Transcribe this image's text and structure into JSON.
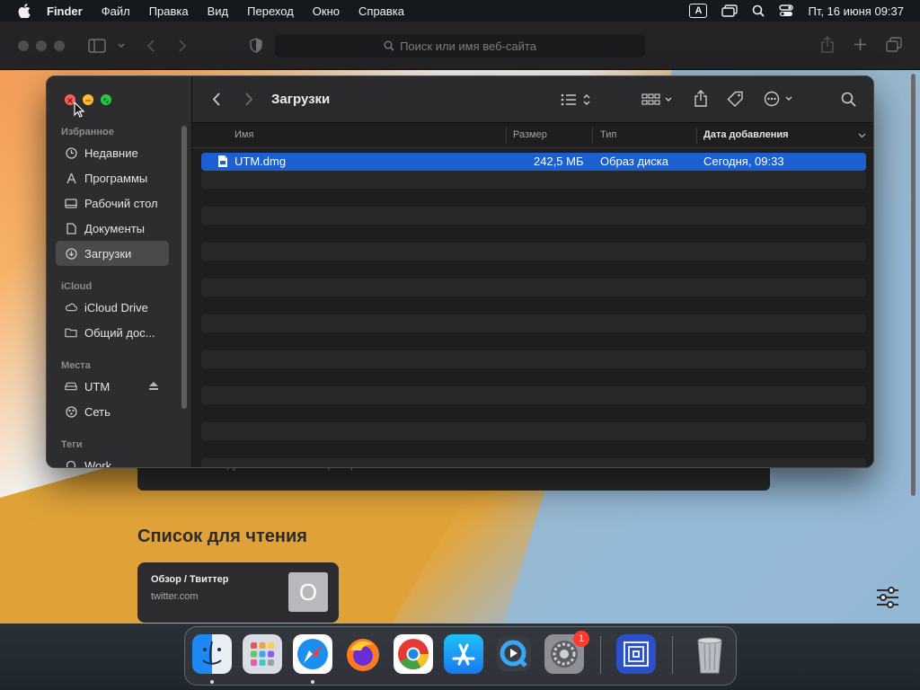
{
  "menubar": {
    "app_name": "Finder",
    "items": [
      "Файл",
      "Правка",
      "Вид",
      "Переход",
      "Окно",
      "Справка"
    ],
    "input_source": "A",
    "datetime": "Пт, 16 июня  09:37"
  },
  "safari": {
    "address_placeholder": "Поиск или имя веб-сайта",
    "privacy_text": "IP-адрес от известных трекеров.",
    "reading_list_title": "Список для чтения",
    "reading_item": {
      "title": "Обзор / Твиттер",
      "url": "twitter.com",
      "thumb_letter": "О"
    }
  },
  "finder": {
    "title": "Загрузки",
    "sidebar": {
      "favorites_label": "Избранное",
      "favorites": [
        {
          "label": "Недавние",
          "icon": "clock-icon"
        },
        {
          "label": "Программы",
          "icon": "applications-icon"
        },
        {
          "label": "Рабочий стол",
          "icon": "desktop-icon"
        },
        {
          "label": "Документы",
          "icon": "document-icon"
        },
        {
          "label": "Загрузки",
          "icon": "download-icon",
          "active": true
        }
      ],
      "icloud_label": "iCloud",
      "icloud": [
        {
          "label": "iCloud Drive",
          "icon": "cloud-icon"
        },
        {
          "label": "Общий дос...",
          "icon": "shared-folder-icon"
        }
      ],
      "places_label": "Места",
      "places": [
        {
          "label": "UTM",
          "icon": "drive-icon"
        },
        {
          "label": "Сеть",
          "icon": "network-icon"
        }
      ],
      "tags_label": "Теги",
      "tags": [
        {
          "label": "Work",
          "icon": "tag-circle-icon"
        }
      ]
    },
    "columns": {
      "name": "Имя",
      "size": "Размер",
      "kind": "Тип",
      "date_added": "Дата добавления"
    },
    "files": [
      {
        "name": "UTM.dmg",
        "size": "242,5 МБ",
        "kind": "Образ диска",
        "date_added": "Сегодня, 09:33"
      }
    ]
  },
  "dock": {
    "apps": [
      "Finder",
      "Launchpad",
      "Safari",
      "Firefox",
      "Chrome",
      "App Store",
      "QuickTime",
      "Системные настройки",
      "UTM",
      "Корзина"
    ],
    "settings_badge": "1"
  },
  "colors": {
    "selection": "#1c5fd0",
    "close": "#ff5f57",
    "minimize": "#febc2e",
    "zoom": "#28c840"
  }
}
